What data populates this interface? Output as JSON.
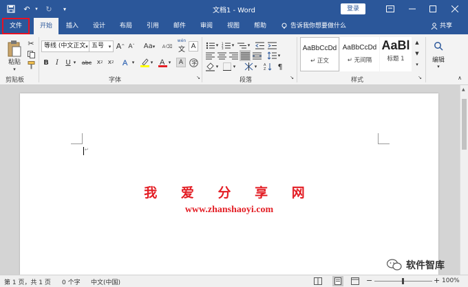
{
  "app": {
    "title": "文档1 - Word",
    "login": "登录"
  },
  "tabs": {
    "file": "文件",
    "items": [
      "开始",
      "插入",
      "设计",
      "布局",
      "引用",
      "邮件",
      "审阅",
      "视图",
      "帮助"
    ],
    "tell_me": "告诉我你想要做什么",
    "share": "共享"
  },
  "ribbon": {
    "clipboard": {
      "paste": "粘贴",
      "label": "剪贴板"
    },
    "font": {
      "font_name": "等线 (中文正文",
      "font_size": "五号",
      "label": "字体",
      "aa": "Aa",
      "wen": "wén",
      "wen_char": "文",
      "a_char": "A"
    },
    "paragraph": {
      "label": "段落"
    },
    "styles": {
      "label": "样式",
      "items": [
        {
          "sample": "AaBbCcDd",
          "name": "正文"
        },
        {
          "sample": "AaBbCcDd",
          "name": "无间隔"
        },
        {
          "sample": "AaBl",
          "name": "标题 1"
        }
      ]
    },
    "editing": {
      "label": "编辑"
    }
  },
  "document": {
    "line1": "我 爱 分 享 网",
    "line2": "www.zhanshaoyi.com",
    "brand_color": "#e31e25"
  },
  "status": {
    "page": "第 1 页，共 1 页",
    "words": "0 个字",
    "language": "中文(中国)",
    "zoom": "100%"
  },
  "overlay": {
    "wechat_name": "软件智库"
  },
  "colors": {
    "title_bar": "#2b579a",
    "ribbon": "#f3f3f3",
    "file_highlight": "#e81123"
  }
}
